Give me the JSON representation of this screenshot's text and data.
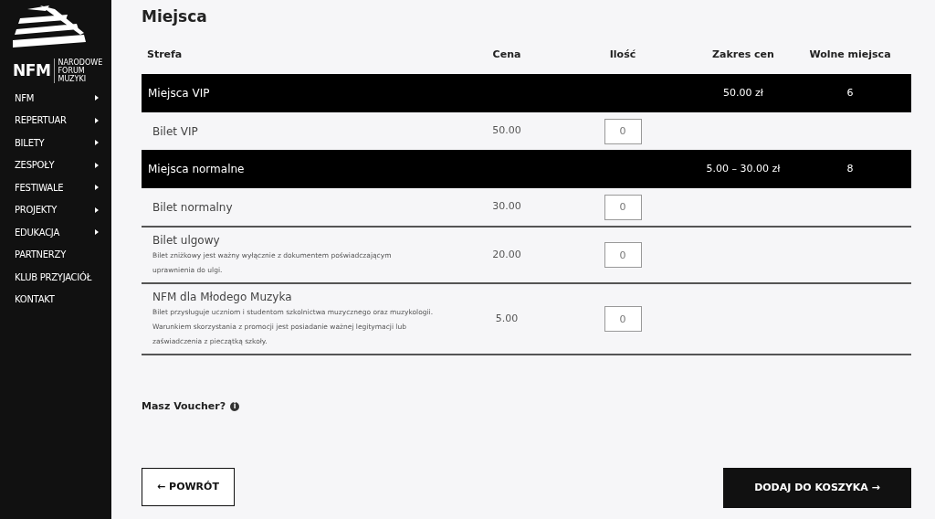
{
  "sidebar": {
    "logo": {
      "text": "NFM",
      "subtitle": [
        "NARODOWE",
        "FORUM",
        "MUZYKI"
      ]
    },
    "items": [
      {
        "label": "NFM",
        "has_submenu": true
      },
      {
        "label": "REPERTUAR",
        "has_submenu": true
      },
      {
        "label": "BILETY",
        "has_submenu": true
      },
      {
        "label": "ZESPOŁY",
        "has_submenu": true
      },
      {
        "label": "FESTIWALE",
        "has_submenu": true
      },
      {
        "label": "PROJEKTY",
        "has_submenu": true
      },
      {
        "label": "EDUKACJA",
        "has_submenu": true
      },
      {
        "label": "PARTNERZY",
        "has_submenu": false
      },
      {
        "label": "KLUB PRZYJACIÓŁ",
        "has_submenu": false
      },
      {
        "label": "KONTAKT",
        "has_submenu": false
      }
    ]
  },
  "title": "Miejsca",
  "table": {
    "columns": [
      "Strefa",
      "Cena",
      "Ilość",
      "Zakres cen",
      "Wolne miejsca"
    ],
    "rows": [
      {
        "kind": "zone",
        "name": "Miejsca VIP",
        "range": "50.00 zł",
        "free": "6"
      },
      {
        "kind": "ticket",
        "name": "Bilet VIP",
        "price": "50.00",
        "quantity": "0"
      },
      {
        "kind": "zone",
        "name": "Miejsca normalne",
        "range": "5.00 – 30.00 zł",
        "free": "8"
      },
      {
        "kind": "ticket",
        "name": "Bilet normalny",
        "price": "30.00",
        "quantity": "0"
      },
      {
        "kind": "ticket",
        "name": "Bilet ulgowy",
        "description": "Bilet zniżkowy jest ważny wyłącznie z dokumentem poświadczającym uprawnienia do ulgi.",
        "price": "20.00",
        "quantity": "0"
      },
      {
        "kind": "ticket",
        "name": "NFM dla Młodego Muzyka",
        "description": "Bilet przysługuje uczniom i studentom szkolnictwa muzycznego oraz muzykologii. Warunkiem skorzystania z promocji jest posiadanie ważnej legitymacji lub zaświadczenia z pieczątką szkoły.",
        "price": "5.00",
        "quantity": "0"
      }
    ]
  },
  "voucher": {
    "label": "Masz Voucher?",
    "info_icon": "i"
  },
  "buttons": {
    "back": {
      "arrow": "←",
      "label": "POWRÓT"
    },
    "add": {
      "label": "DODAJ DO KOSZYKA",
      "arrow": "→"
    }
  }
}
